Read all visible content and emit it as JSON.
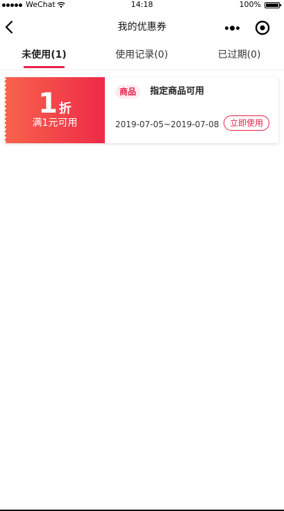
{
  "status_bar": {
    "carrier": "WeChat",
    "time": "14:18",
    "battery_percent": "100%",
    "battery_level": 1.0
  },
  "nav": {
    "title": "我的优惠券"
  },
  "tabs": [
    {
      "label": "未使用(1)",
      "active": true
    },
    {
      "label": "使用记录(0)",
      "active": false
    },
    {
      "label": "已过期(0)",
      "active": false
    }
  ],
  "coupons": [
    {
      "discount_value": "1",
      "discount_unit": "折",
      "threshold": "满1元可用",
      "tag": "商品",
      "description": "指定商品可用",
      "validity": "2019-07-05~2019-07-08",
      "action_label": "立即使用"
    }
  ],
  "colors": {
    "accent": "#e5214a",
    "gradient_start": "#f7634c",
    "gradient_end": "#ee2a48",
    "tag_bg": "#fdecef"
  }
}
